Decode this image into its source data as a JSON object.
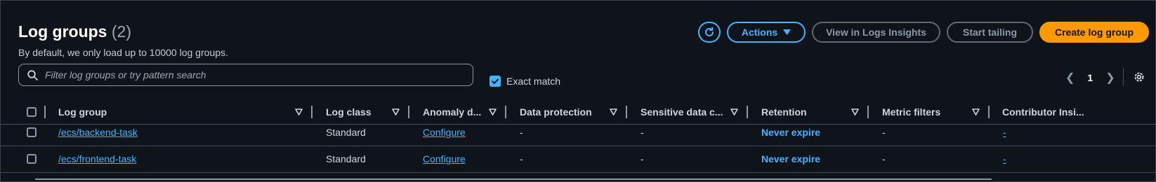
{
  "header": {
    "title": "Log groups",
    "count": "(2)",
    "subtitle": "By default, we only load up to 10000 log groups."
  },
  "toolbar": {
    "refresh_icon": "refresh-icon",
    "actions_label": "Actions",
    "insights_label": "View in Logs Insights",
    "tailing_label": "Start tailing",
    "create_label": "Create log group"
  },
  "search": {
    "placeholder": "Filter log groups or try pattern search",
    "value": "",
    "exact_match_label": "Exact match",
    "exact_match_checked": true
  },
  "pagination": {
    "current_page": "1"
  },
  "table": {
    "columns": [
      "Log group",
      "Log class",
      "Anomaly d...",
      "Data protection",
      "Sensitive data c...",
      "Retention",
      "Metric filters",
      "Contributor Insi..."
    ],
    "rows": [
      {
        "log_group": "/ecs/backend-task",
        "log_class": "Standard",
        "anomaly": "Configure",
        "data_protection": "-",
        "sensitive": "-",
        "retention": "Never expire",
        "metric_filters": "-",
        "contributor": "-"
      },
      {
        "log_group": "/ecs/frontend-task",
        "log_class": "Standard",
        "anomaly": "Configure",
        "data_protection": "-",
        "sensitive": "-",
        "retention": "Never expire",
        "metric_filters": "-",
        "contributor": "-"
      }
    ]
  },
  "colors": {
    "background": "#0f141a",
    "accent": "#42b4ff",
    "primary_button": "#ff9900"
  }
}
